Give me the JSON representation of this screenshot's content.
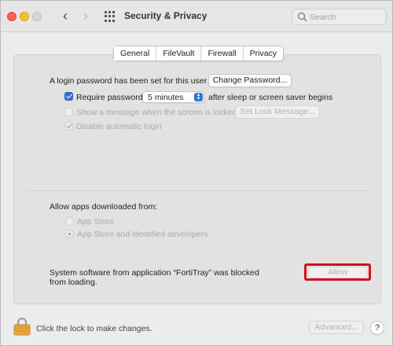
{
  "window": {
    "title": "Security & Privacy",
    "search_placeholder": "Search",
    "back_glyph": "‹",
    "forward_glyph": "›"
  },
  "tabs": [
    {
      "label": "General",
      "selected": true
    },
    {
      "label": "FileVault",
      "selected": false
    },
    {
      "label": "Firewall",
      "selected": false
    },
    {
      "label": "Privacy",
      "selected": false
    }
  ],
  "general": {
    "login_password_text": "A login password has been set for this user",
    "change_password_button": "Change Password...",
    "require_password": {
      "label": "Require password",
      "checked": true
    },
    "require_password_delay": "5 minutes",
    "after_sleep_text": "after sleep or screen saver begins",
    "show_message": {
      "label": "Show a message when the screen is locked",
      "checked": false,
      "enabled": false
    },
    "set_lock_message_button": "Set Lock Message...",
    "disable_auto_login": {
      "label": "Disable automatic login",
      "checked": true,
      "enabled": false
    }
  },
  "apps": {
    "heading": "Allow apps downloaded from:",
    "options": [
      {
        "label": "App Store",
        "selected": false
      },
      {
        "label": "App Store and identified developers",
        "selected": true
      }
    ]
  },
  "blocked": {
    "message_line1": "System software from application “FortiTray” was blocked",
    "message_line2": "from loading.",
    "allow_button": "Allow"
  },
  "footer": {
    "lock_text": "Click the lock to make changes.",
    "advanced_button": "Advanced...",
    "help_button": "?"
  },
  "colors": {
    "accent": "#2e72d8",
    "highlight": "#d0101e"
  }
}
